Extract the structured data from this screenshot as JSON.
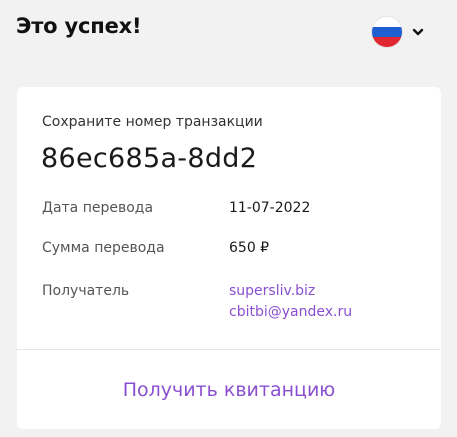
{
  "header": {
    "title": "Это успех!",
    "language": {
      "flag_icon": "russia-flag-icon",
      "flag_colors": [
        "#ffffff",
        "#1f5fd0",
        "#e0262e"
      ],
      "dropdown_icon": "chevron-down-icon"
    }
  },
  "card": {
    "save_label": "Сохраните номер транзакции",
    "transaction_id": "86ec685a-8dd2",
    "rows": [
      {
        "label": "Дата перевода",
        "value": "11-07-2022"
      },
      {
        "label": "Сумма перевода",
        "value": "650 ₽"
      },
      {
        "label": "Получатель",
        "links": [
          "supersliv.biz",
          "cbitbi@yandex.ru"
        ]
      }
    ],
    "receipt_button": "Получить квитанцию"
  },
  "colors": {
    "background": "#f2f2f2",
    "card": "#ffffff",
    "accent": "#8a4fd1"
  }
}
